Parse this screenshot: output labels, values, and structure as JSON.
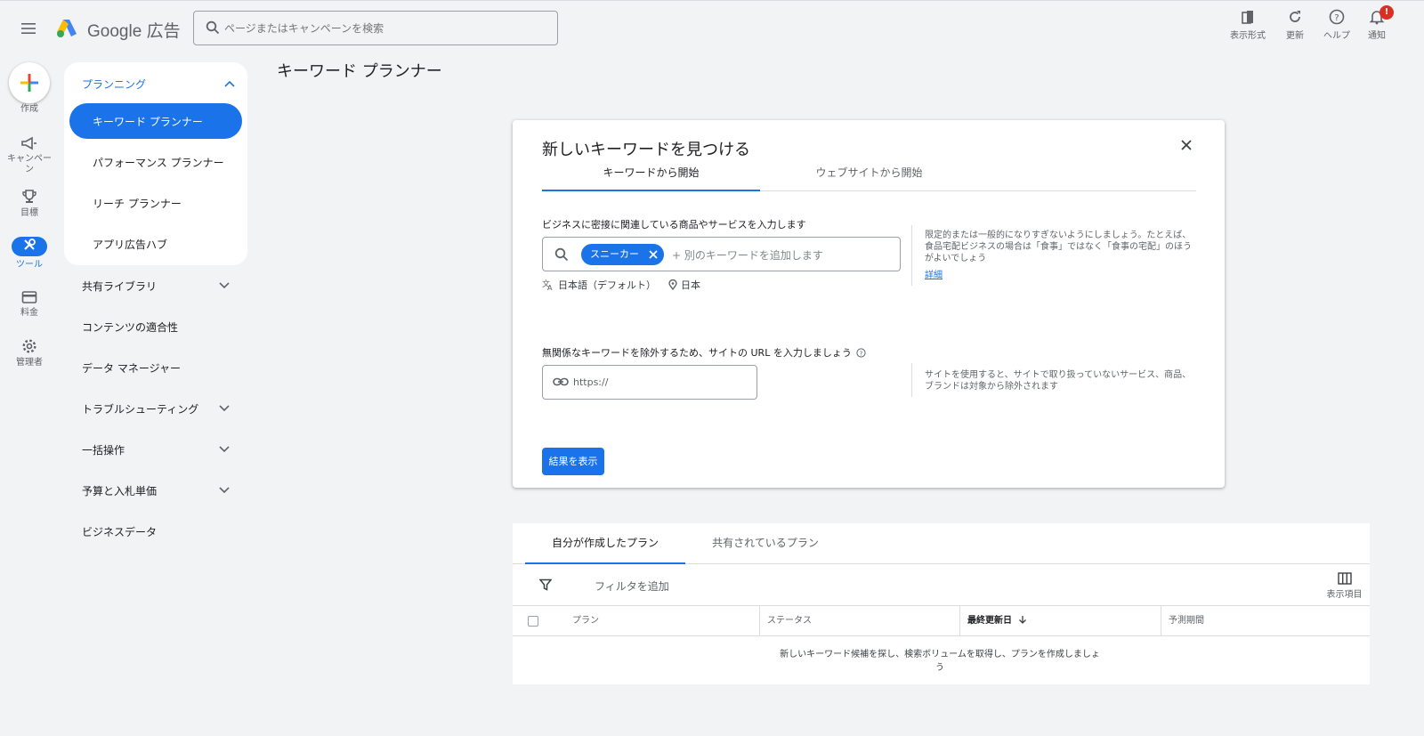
{
  "header": {
    "logo_text_google": "Google",
    "logo_text_product": "広告",
    "search_placeholder": "ページまたはキャンペーンを検索",
    "tools": [
      {
        "label": "表示形式",
        "icon": "appearance-icon"
      },
      {
        "label": "更新",
        "icon": "refresh-icon"
      },
      {
        "label": "ヘルプ",
        "icon": "help-icon"
      },
      {
        "label": "通知",
        "icon": "bell-icon",
        "badge": "!"
      }
    ]
  },
  "rail": {
    "create": "作成",
    "campaigns": "キャンペーン",
    "goals": "目標",
    "tools": "ツール",
    "billing": "料金",
    "admin": "管理者"
  },
  "sidenav": {
    "planning": "プランニング",
    "planning_items": [
      "キーワード プランナー",
      "パフォーマンス プランナー",
      "リーチ プランナー",
      "アプリ広告ハブ"
    ],
    "sections": [
      "共有ライブラリ",
      "コンテンツの適合性",
      "データ マネージャー",
      "トラブルシューティング",
      "一括操作",
      "予算と入札単価",
      "ビジネスデータ"
    ]
  },
  "page": {
    "title": "キーワード プランナー"
  },
  "kw_card": {
    "title": "新しいキーワードを見つける",
    "tabs": [
      "キーワードから開始",
      "ウェブサイトから開始"
    ],
    "keywords_label": "ビジネスに密接に関連している商品やサービスを入力します",
    "chip": "スニーカー",
    "add_placeholder": "+ 別のキーワードを追加します",
    "language": "日本語（デフォルト）",
    "location": "日本",
    "hint1": "限定的または一般的になりすぎないようにしましょう。たとえば、食品宅配ビジネスの場合は「食事」ではなく「食事の宅配」のほうがよいでしょう",
    "hint1_link": "詳細",
    "url_label": "無関係なキーワードを除外するため、サイトの URL を入力しましょう",
    "url_placeholder": "https://",
    "hint2": "サイトを使用すると、サイトで取り扱っていないサービス、商品、ブランドは対象から除外されます",
    "submit": "結果を表示"
  },
  "plans": {
    "tabs": [
      "自分が作成したプラン",
      "共有されているプラン"
    ],
    "filter": "フィルタを追加",
    "columns_btn": "表示項目",
    "headers": [
      "プラン",
      "ステータス",
      "最終更新日",
      "予測期間"
    ],
    "empty": "新しいキーワード候補を探し、検索ボリュームを取得し、プランを作成しましょう"
  }
}
